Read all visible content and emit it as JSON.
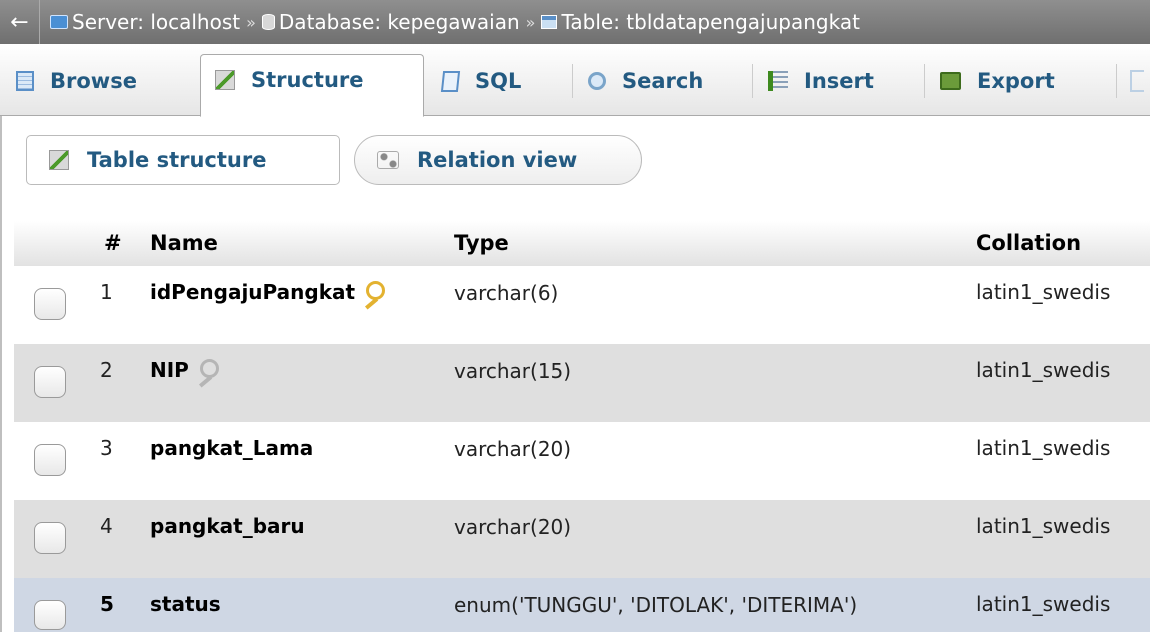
{
  "breadcrumb": {
    "back": "←",
    "server": "Server: localhost",
    "database": "Database: kepegawaian",
    "table": "Table: tbldatapengajupangkat",
    "separator": "»"
  },
  "tabs": [
    {
      "label": "Browse",
      "icon": "browse-icon"
    },
    {
      "label": "Structure",
      "icon": "structure-icon",
      "active": true
    },
    {
      "label": "SQL",
      "icon": "sql-icon"
    },
    {
      "label": "Search",
      "icon": "search-icon"
    },
    {
      "label": "Insert",
      "icon": "insert-icon"
    },
    {
      "label": "Export",
      "icon": "export-icon"
    }
  ],
  "subnav": {
    "table_structure": "Table structure",
    "relation_view": "Relation view"
  },
  "table": {
    "headers": {
      "num": "#",
      "name": "Name",
      "type": "Type",
      "collation": "Collation"
    },
    "rows": [
      {
        "num": "1",
        "name": "idPengajuPangkat",
        "key": "primary",
        "type": "varchar(6)",
        "collation": "latin1_swedis"
      },
      {
        "num": "2",
        "name": "NIP",
        "key": "index",
        "type": "varchar(15)",
        "collation": "latin1_swedis"
      },
      {
        "num": "3",
        "name": "pangkat_Lama",
        "key": "",
        "type": "varchar(20)",
        "collation": "latin1_swedis"
      },
      {
        "num": "4",
        "name": "pangkat_baru",
        "key": "",
        "type": "varchar(20)",
        "collation": "latin1_swedis"
      },
      {
        "num": "5",
        "name": "status",
        "key": "",
        "type": "enum('TUNGGU', 'DITOLAK', 'DITERIMA')",
        "collation": "latin1_swedis"
      }
    ]
  },
  "colors": {
    "link": "#235a81",
    "row_even": "#dfdfdf",
    "row_hover": "#cfd7e4",
    "breadcrumb_bg": "#7f7f7f"
  }
}
